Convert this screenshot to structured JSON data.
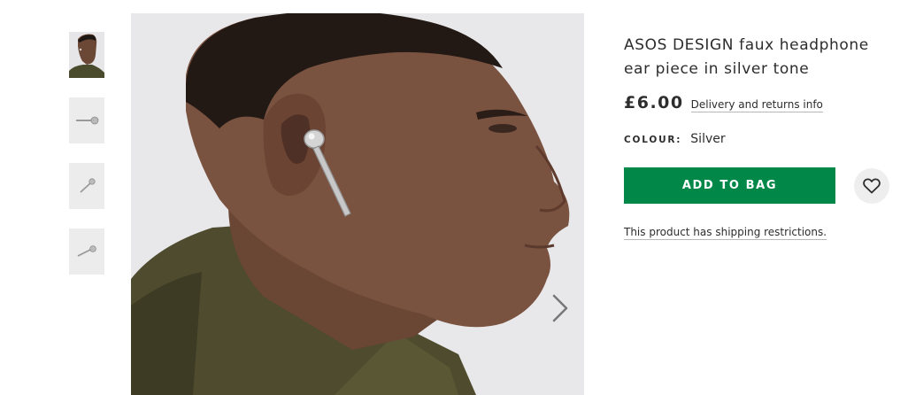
{
  "gallery": {
    "thumbnails": [
      {
        "name": "model-thumbnail"
      },
      {
        "name": "earpiece-side-thumbnail"
      },
      {
        "name": "earpiece-angle-thumbnail"
      },
      {
        "name": "earpiece-flat-thumbnail"
      }
    ],
    "next_icon": "chevron-right-icon"
  },
  "product": {
    "title": "ASOS DESIGN faux headphone ear piece in silver tone",
    "price": "£6.00",
    "delivery_link": "Delivery and returns info",
    "colour_label": "COLOUR:",
    "colour_value": "Silver",
    "add_to_bag_label": "ADD TO BAG",
    "save_icon": "heart-icon",
    "shipping_notice": "This product has shipping restrictions."
  },
  "colors": {
    "add_to_bag_bg": "#018849",
    "text": "#2d2d2d",
    "save_bg": "#eeeeee"
  }
}
